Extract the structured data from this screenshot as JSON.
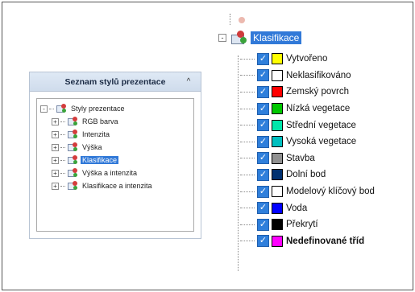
{
  "left_panel": {
    "title": "Seznam stylů prezentace",
    "collapse_glyph": "^",
    "tree": {
      "root": {
        "label": "Styly prezentace",
        "expander": "-"
      },
      "children": [
        {
          "label": "RGB barva",
          "expander": "+",
          "selected": false
        },
        {
          "label": "Intenzita",
          "expander": "+",
          "selected": false
        },
        {
          "label": "Výška",
          "expander": "+",
          "selected": false
        },
        {
          "label": "Klasifikace",
          "expander": "+",
          "selected": true
        },
        {
          "label": "Výška a intenzita",
          "expander": "+",
          "selected": false
        },
        {
          "label": "Klasifikace a intenzita",
          "expander": "+",
          "selected": false
        }
      ]
    }
  },
  "right_tree": {
    "root": {
      "label": "Klasifikace",
      "expander": "-"
    },
    "checkbox_glyph": "✓",
    "classes": [
      {
        "label": "Vytvořeno",
        "color": "#ffff00",
        "checked": true,
        "bold": false
      },
      {
        "label": "Neklasifikováno",
        "color": "#ffffff",
        "checked": true,
        "bold": false
      },
      {
        "label": "Zemský povrch",
        "color": "#ff0000",
        "checked": true,
        "bold": false
      },
      {
        "label": "Nízká vegetace",
        "color": "#00c800",
        "checked": true,
        "bold": false
      },
      {
        "label": "Střední vegetace",
        "color": "#00e6aa",
        "checked": true,
        "bold": false
      },
      {
        "label": "Vysoká vegetace",
        "color": "#00c0c0",
        "checked": true,
        "bold": false
      },
      {
        "label": "Stavba",
        "color": "#909090",
        "checked": true,
        "bold": false
      },
      {
        "label": "Dolní bod",
        "color": "#003070",
        "checked": true,
        "bold": false
      },
      {
        "label": "Modelový klíčový bod",
        "color": "#ffffff",
        "checked": true,
        "bold": false
      },
      {
        "label": "Voda",
        "color": "#0000ff",
        "checked": true,
        "bold": false
      },
      {
        "label": "Překrytí",
        "color": "#000000",
        "checked": true,
        "bold": false
      },
      {
        "label": "Nedefinované tříd",
        "color": "#ff00ff",
        "checked": true,
        "bold": true
      }
    ]
  },
  "colors": {
    "selection": "#3179d8",
    "checkbox": "#2f7fdb",
    "panel_header": "#cfdcec"
  }
}
